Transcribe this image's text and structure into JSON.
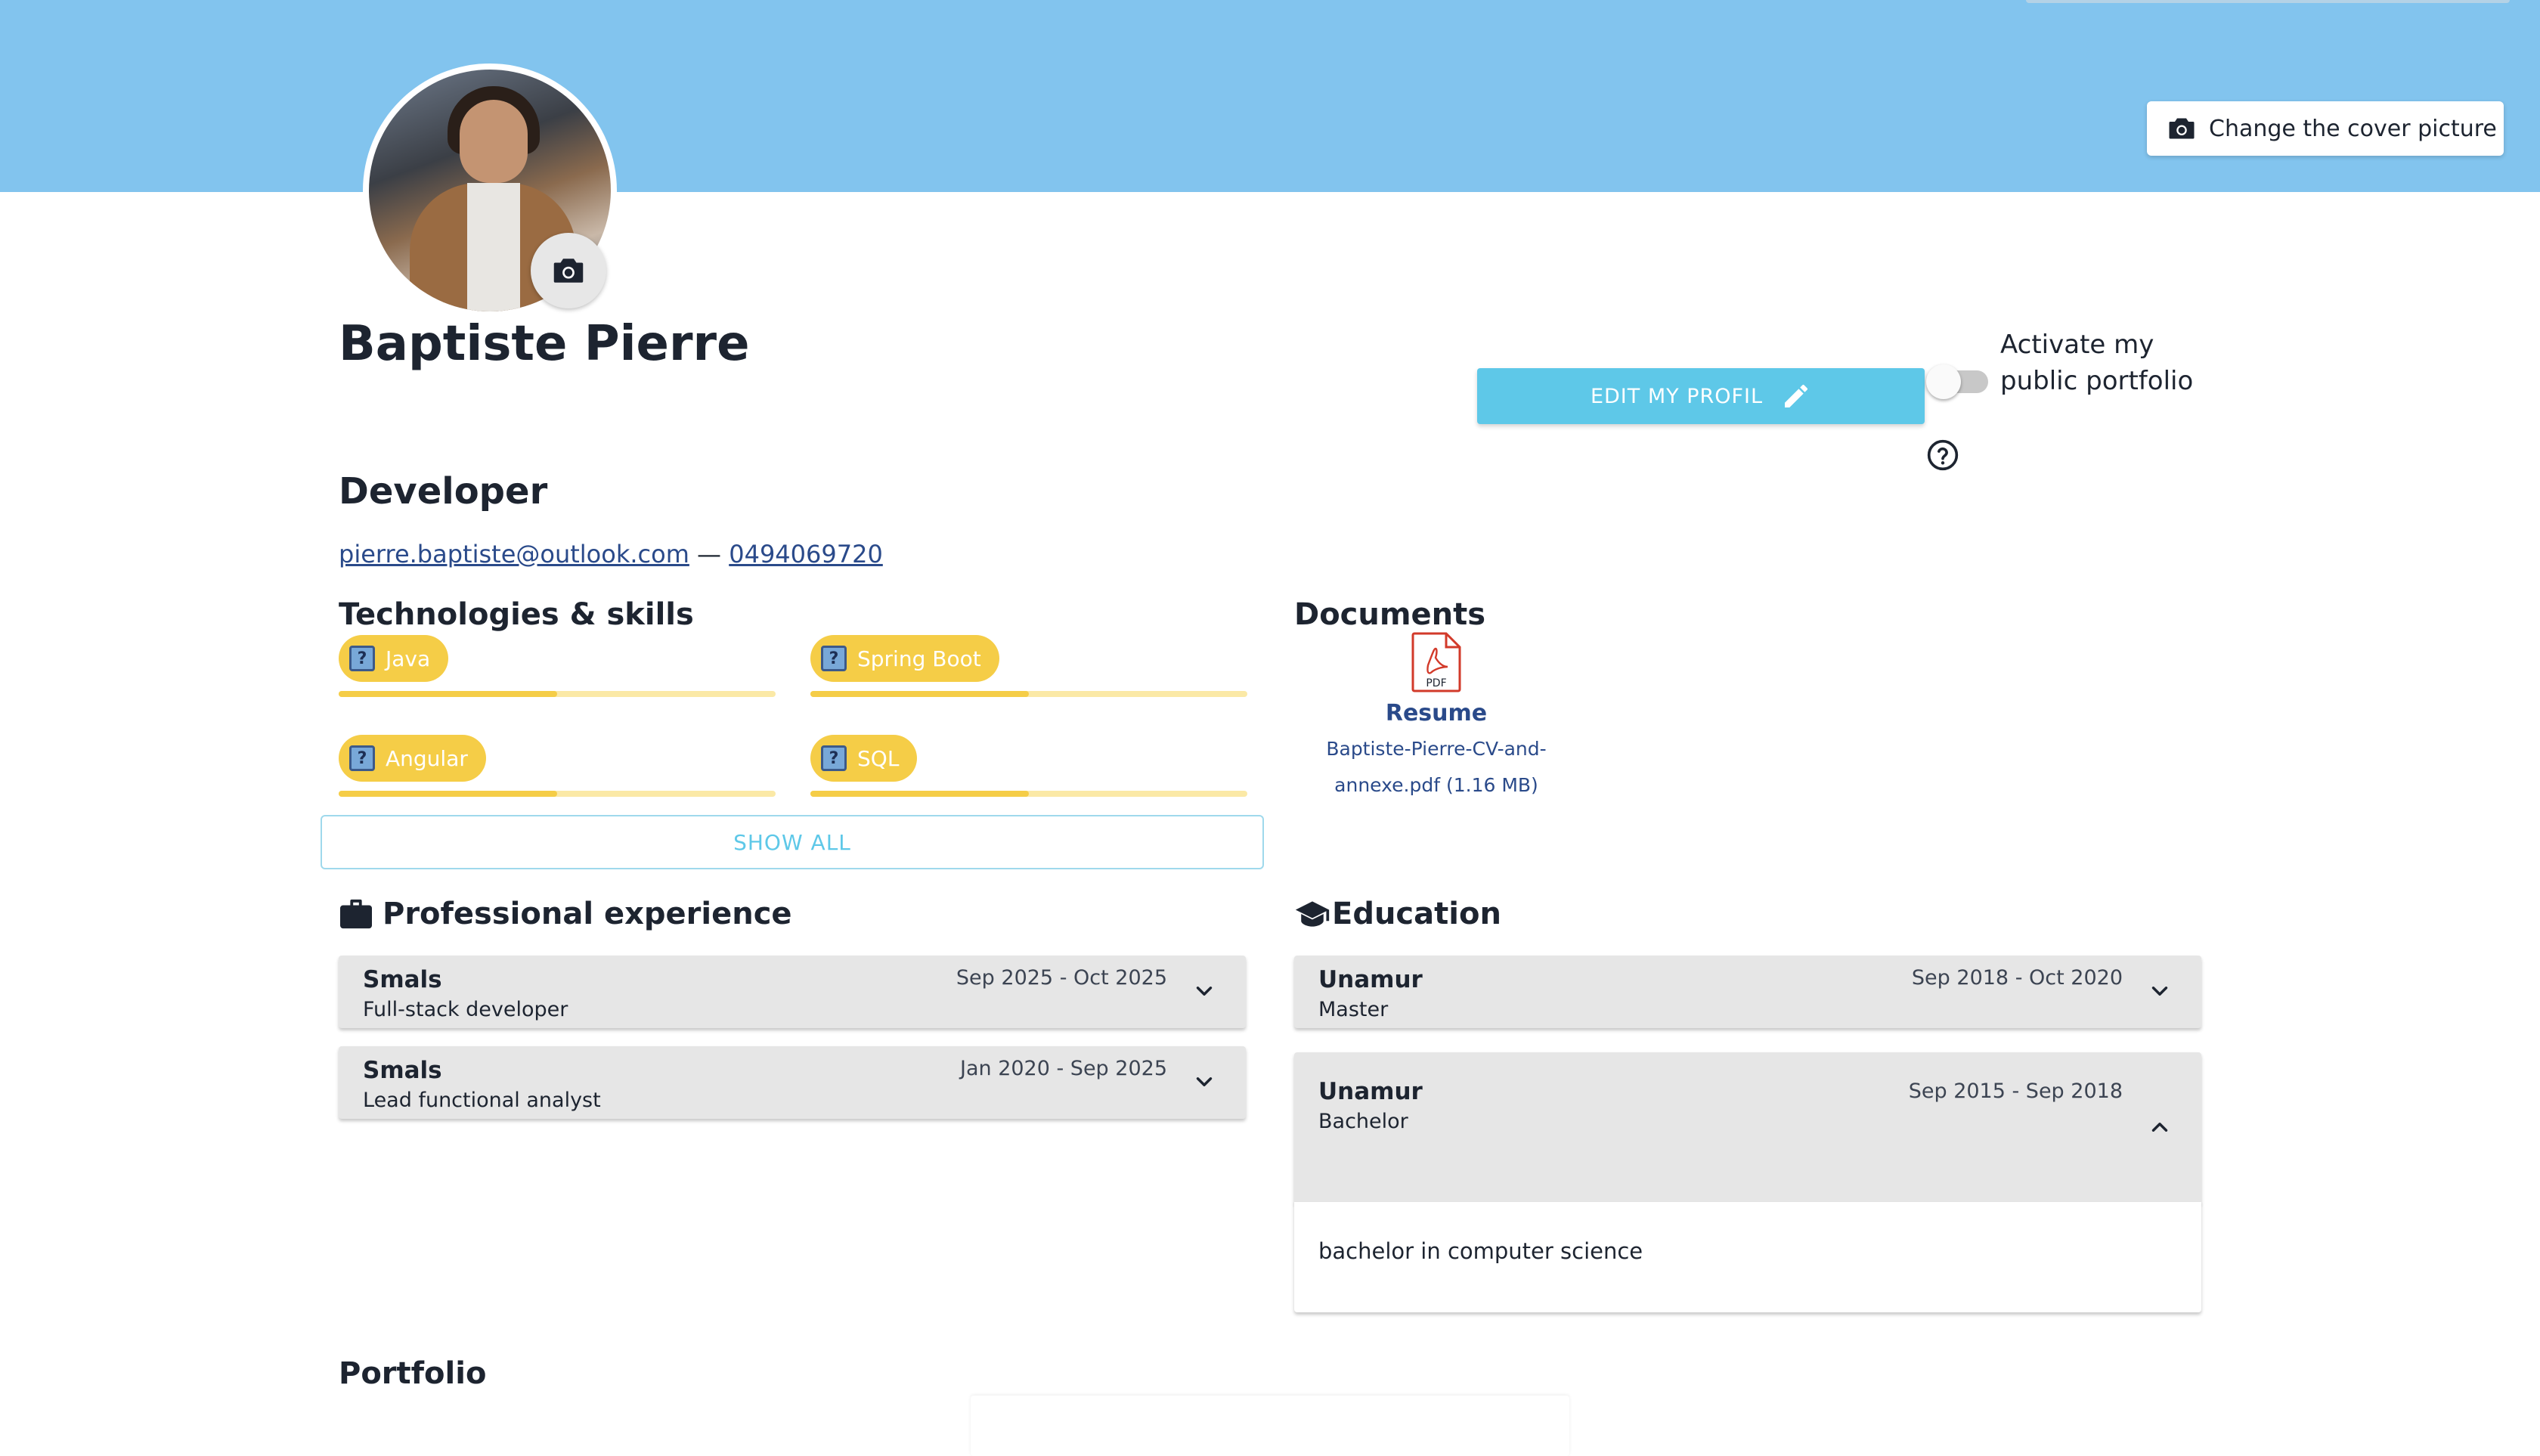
{
  "cover": {
    "button_label": "Change the cover picture"
  },
  "profile": {
    "name": "Baptiste Pierre",
    "role": "Developer",
    "email": "pierre.baptiste@outlook.com",
    "separator": " — ",
    "phone": "0494069720",
    "edit_button": "EDIT MY PROFIL",
    "public_toggle_label": "Activate my public portfolio",
    "public_toggle_on": false
  },
  "skills": {
    "title": "Technologies & skills",
    "items": [
      {
        "name": "Java",
        "level": 0.5
      },
      {
        "name": "Spring Boot",
        "level": 0.5
      },
      {
        "name": "Angular",
        "level": 0.5
      },
      {
        "name": "SQL",
        "level": 0.5
      }
    ],
    "show_all": "SHOW ALL",
    "chip_icon": "?"
  },
  "documents": {
    "title": "Documents",
    "items": [
      {
        "name": "Resume",
        "file": "Baptiste-Pierre-CV-and-annexe.pdf (1.16 MB)",
        "icon_label": "PDF"
      }
    ]
  },
  "experience": {
    "title": "Professional experience",
    "items": [
      {
        "org": "Smals",
        "position": "Full-stack developer",
        "dates": "Sep 2025 - Oct 2025"
      },
      {
        "org": "Smals",
        "position": "Lead functional analyst",
        "dates": "Jan 2020 - Sep 2025"
      }
    ]
  },
  "education": {
    "title": "Education",
    "items": [
      {
        "org": "Unamur",
        "degree": "Master",
        "dates": "Sep 2018 - Oct 2020",
        "expanded": false
      },
      {
        "org": "Unamur",
        "degree": "Bachelor",
        "dates": "Sep 2015 - Sep 2018",
        "expanded": true,
        "description": "bachelor in computer science"
      }
    ]
  },
  "portfolio": {
    "title": "Portfolio"
  },
  "colors": {
    "cover": "#82c4ee",
    "accent": "#5ec8e8",
    "skill_chip": "#f5cd47",
    "link": "#2a4a8a"
  }
}
